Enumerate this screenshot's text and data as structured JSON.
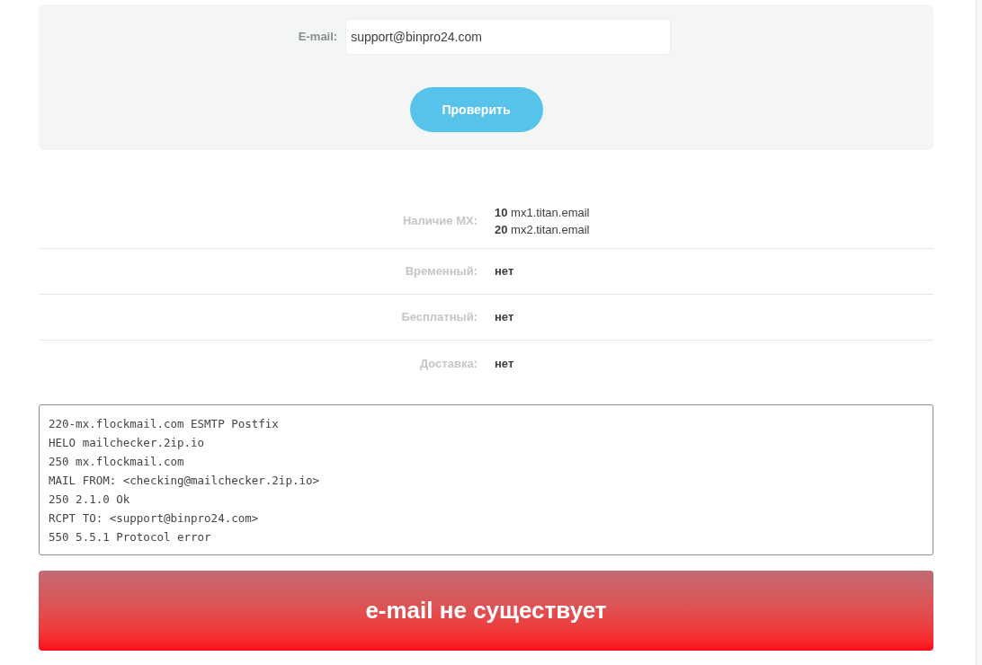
{
  "form": {
    "label": "E-mail:",
    "email": {
      "value": "support@binpro24.com"
    },
    "submit": "Проверить"
  },
  "results": [
    {
      "kind": "list",
      "label": "Наличие MX:",
      "lines": [
        "**10** mx1.titan.email",
        "**20** mx2.titan.email"
      ]
    },
    {
      "kind": "flag",
      "label": "Временный:",
      "value": "нет"
    },
    {
      "kind": "flag",
      "label": "Бесплатный:",
      "value": "нет"
    },
    {
      "kind": "flag",
      "label": "Доставка:",
      "value": "нет"
    }
  ],
  "smtp_log": [
    "220-mx.flockmail.com ESMTP Postfix",
    "HELO mailchecker.2ip.io",
    "250 mx.flockmail.com",
    "MAIL FROM: <checking@mailchecker.2ip.io>",
    "250 2.1.0 Ok",
    "RCPT TO: <support@binpro24.com>",
    "550 5.5.1 Protocol error"
  ],
  "verdict": {
    "kind": "error",
    "text": "e-mail не существует"
  }
}
